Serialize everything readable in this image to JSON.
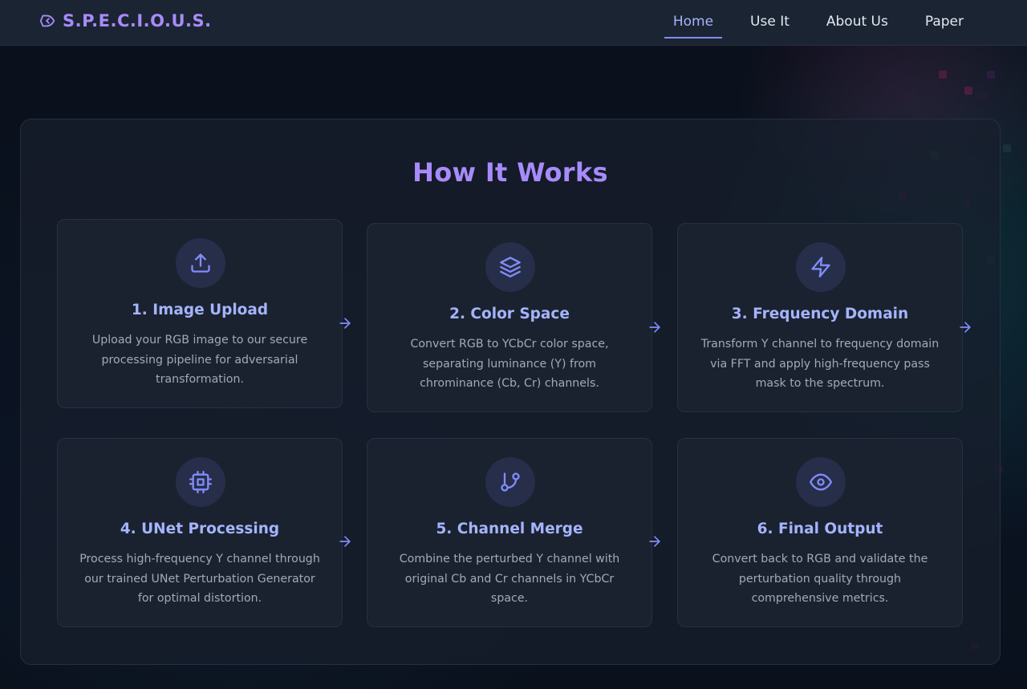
{
  "nav": {
    "logo_text": "S.P.E.C.I.O.U.S.",
    "links": [
      {
        "label": "Home",
        "active": true
      },
      {
        "label": "Use It",
        "active": false
      },
      {
        "label": "About Us",
        "active": false
      },
      {
        "label": "Paper",
        "active": false
      }
    ]
  },
  "section": {
    "title": "How It Works",
    "steps": [
      {
        "title": "1. Image Upload",
        "icon": "upload-icon",
        "description": "Upload your RGB image to our secure processing pipeline for adversarial transformation."
      },
      {
        "title": "2. Color Space",
        "icon": "layers-icon",
        "description": "Convert RGB to YCbCr color space, separating luminance (Y) from chrominance (Cb, Cr) channels."
      },
      {
        "title": "3. Frequency Domain",
        "icon": "lightning-icon",
        "description": "Transform Y channel to frequency domain via FFT and apply high-frequency pass mask to the spectrum."
      },
      {
        "title": "4. UNet Processing",
        "icon": "cpu-icon",
        "description": "Process high-frequency Y channel through our trained UNet Perturbation Generator for optimal distortion."
      },
      {
        "title": "5. Channel Merge",
        "icon": "git-branch-icon",
        "description": "Combine the perturbed Y channel with original Cb and Cr channels in YCbCr space."
      },
      {
        "title": "6. Final Output",
        "icon": "eye-icon",
        "description": "Convert back to RGB and validate the perturbation quality through comprehensive metrics."
      }
    ]
  },
  "colors": {
    "accent": "#a78bfa",
    "card_title": "#a5b4fc",
    "icon_stroke": "#818cf8",
    "background": "#0b1220"
  }
}
